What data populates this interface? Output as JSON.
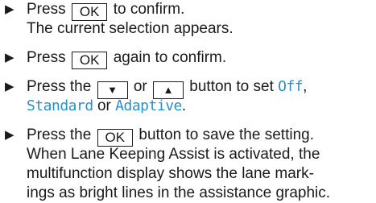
{
  "steps": [
    {
      "bullet": "▶",
      "before": "Press",
      "key": "OK",
      "after": "to confirm.",
      "line2": "The current selection appears."
    },
    {
      "bullet": "▶",
      "before": "Press",
      "key": "OK",
      "after": "again to confirm."
    },
    {
      "bullet": "▶",
      "before": "Press the",
      "key_down": "▼",
      "or": "or",
      "key_up": "▲",
      "after": "button to set",
      "option_off": "Off",
      "comma": ",",
      "option_standard": "Standard",
      "or2": "or",
      "option_adaptive": "Adaptive",
      "period": "."
    },
    {
      "bullet": "▶",
      "before": "Press the",
      "key": "OK",
      "after": "button to save the setting.",
      "line2": "When Lane Keeping Assist is activated, the",
      "line3": "multifunction display shows the lane mark-",
      "line4": "ings as bright lines in the assistance graphic."
    }
  ],
  "colors": {
    "highlight": "#2a8fc9",
    "text": "#1a1a1a"
  }
}
